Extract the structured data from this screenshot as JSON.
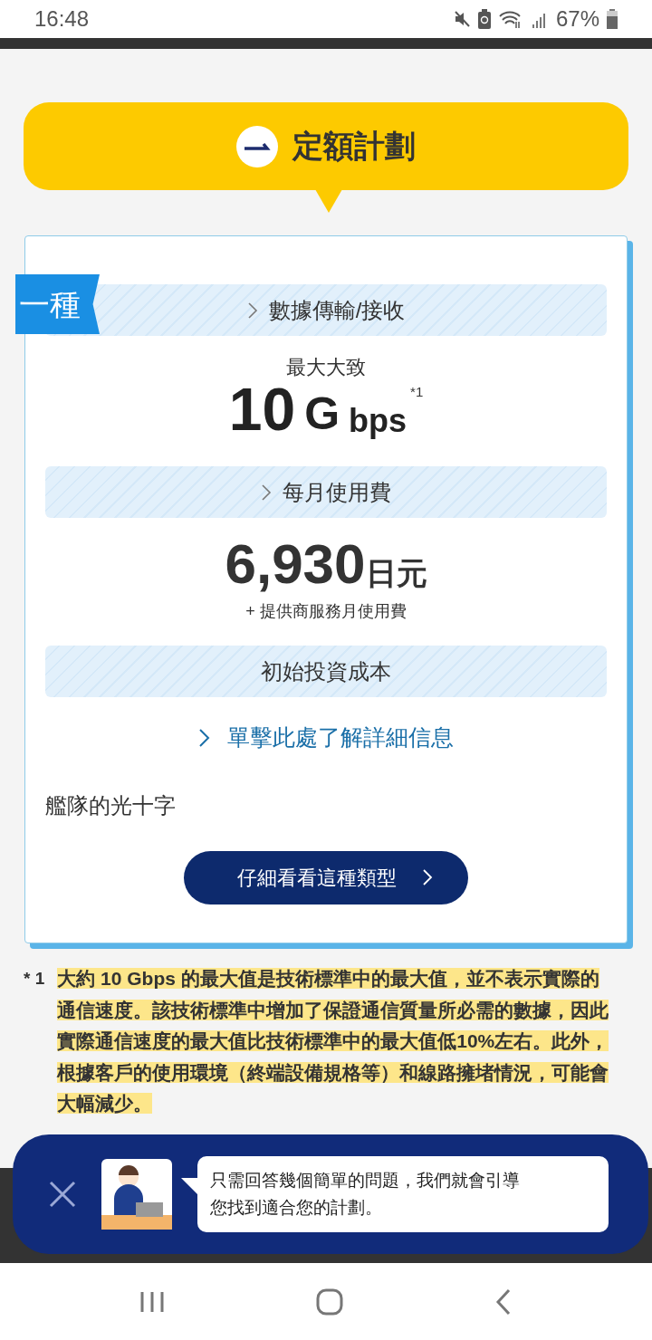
{
  "status_bar": {
    "time": "16:48",
    "battery": "67%"
  },
  "plan_header": {
    "title": "定額計劃"
  },
  "plan_card": {
    "ribbon": "一種",
    "sections": [
      {
        "kind": "speed",
        "label": "數據傳輸/接收",
        "has_chevron": true,
        "caption": "最大大致",
        "value": "10",
        "unit_prefix": "G",
        "unit": "bps",
        "footnote_mark": "*1"
      },
      {
        "kind": "price",
        "label": "每月使用費",
        "has_chevron": true,
        "value": "6,930",
        "unit": "日元",
        "note": "+ 提供商服務月使用費"
      },
      {
        "kind": "link",
        "label": "初始投資成本",
        "has_chevron": false,
        "link": "單擊此處了解詳細信息"
      }
    ],
    "description": "艦隊的光十字",
    "button": "仔細看看這種類型"
  },
  "footnote": {
    "mark": "* 1",
    "text": "大約 10 Gbps 的最大值是技術標準中的最大值，並不表示實際的通信速度。該技術標準中增加了保證通信質量所必需的數據，因此實際通信速度的最大值比技術標準中的最大值低10%左右。此外，根據客戶的使用環境（終端設備規格等）和線路擁堵情況，可能會大幅減少。"
  },
  "assistant_banner": {
    "message": "只需回答幾個簡單的問題，我們就會引導您找到適合您的計劃。"
  }
}
